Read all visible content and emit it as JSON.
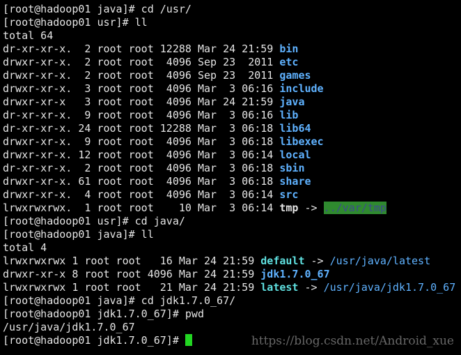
{
  "terminal": {
    "background": "#000000",
    "foreground": "#e5e5e5",
    "dir_color": "#5fb2ff",
    "link_color": "#5fe0e0",
    "cursor_color": "#22d622",
    "lines": [
      {
        "type": "cmd",
        "text": "[root@hadoop01 java]# cd /usr/"
      },
      {
        "type": "cmd",
        "text": "[root@hadoop01 usr]# ll"
      },
      {
        "type": "plain",
        "text": "total 64"
      },
      {
        "type": "entry",
        "meta": "dr-xr-xr-x.  2 root root 12288 Mar 24 21:59 ",
        "name": "bin",
        "kind": "dir"
      },
      {
        "type": "entry",
        "meta": "drwxr-xr-x.  2 root root  4096 Sep 23  2011 ",
        "name": "etc",
        "kind": "dir"
      },
      {
        "type": "entry",
        "meta": "drwxr-xr-x.  2 root root  4096 Sep 23  2011 ",
        "name": "games",
        "kind": "dir"
      },
      {
        "type": "entry",
        "meta": "drwxr-xr-x.  3 root root  4096 Mar  3 06:16 ",
        "name": "include",
        "kind": "dir"
      },
      {
        "type": "entry",
        "meta": "drwxr-xr-x   3 root root  4096 Mar 24 21:59 ",
        "name": "java",
        "kind": "dir"
      },
      {
        "type": "entry",
        "meta": "dr-xr-xr-x.  9 root root  4096 Mar  3 06:16 ",
        "name": "lib",
        "kind": "dir"
      },
      {
        "type": "entry",
        "meta": "dr-xr-xr-x. 24 root root 12288 Mar  3 06:18 ",
        "name": "lib64",
        "kind": "dir"
      },
      {
        "type": "entry",
        "meta": "drwxr-xr-x.  9 root root  4096 Mar  3 06:18 ",
        "name": "libexec",
        "kind": "dir"
      },
      {
        "type": "entry",
        "meta": "drwxr-xr-x. 12 root root  4096 Mar  3 06:14 ",
        "name": "local",
        "kind": "dir"
      },
      {
        "type": "entry",
        "meta": "dr-xr-xr-x.  2 root root  4096 Mar  3 06:18 ",
        "name": "sbin",
        "kind": "dir"
      },
      {
        "type": "entry",
        "meta": "drwxr-xr-x. 61 root root  4096 Mar  3 06:18 ",
        "name": "share",
        "kind": "dir"
      },
      {
        "type": "entry",
        "meta": "drwxr-xr-x.  4 root root  4096 Mar  3 06:14 ",
        "name": "src",
        "kind": "dir"
      },
      {
        "type": "link",
        "meta": "lrwxrwxrwx.  1 root root    10 Mar  3 06:14 ",
        "name": "tmp",
        "kind": "tmp",
        "arrow": " -> ",
        "target": "../var/tmp",
        "target_kind": "bad"
      },
      {
        "type": "cmd",
        "text": "[root@hadoop01 usr]# cd java/"
      },
      {
        "type": "cmd",
        "text": "[root@hadoop01 java]# ll"
      },
      {
        "type": "plain",
        "text": "total 4"
      },
      {
        "type": "link",
        "meta": "lrwxrwxrwx 1 root root   16 Mar 24 21:59 ",
        "name": "default",
        "kind": "link",
        "arrow": " -> ",
        "target": "/usr/java/latest",
        "target_kind": "dir"
      },
      {
        "type": "entry",
        "meta": "drwxr-xr-x 8 root root 4096 Mar 24 21:59 ",
        "name": "jdk1.7.0_67",
        "kind": "dir"
      },
      {
        "type": "link",
        "meta": "lrwxrwxrwx 1 root root   21 Mar 24 21:59 ",
        "name": "latest",
        "kind": "link",
        "arrow": " -> ",
        "target": "/usr/java/jdk1.7.0_67",
        "target_kind": "dir"
      },
      {
        "type": "cmd",
        "text": "[root@hadoop01 java]# cd jdk1.7.0_67/"
      },
      {
        "type": "cmd",
        "text": "[root@hadoop01 jdk1.7.0_67]# pwd"
      },
      {
        "type": "plain",
        "text": "/usr/java/jdk1.7.0_67"
      },
      {
        "type": "prompt",
        "text": "[root@hadoop01 jdk1.7.0_67]# "
      }
    ]
  },
  "watermark": "https://blog.csdn.net/Android_xue"
}
